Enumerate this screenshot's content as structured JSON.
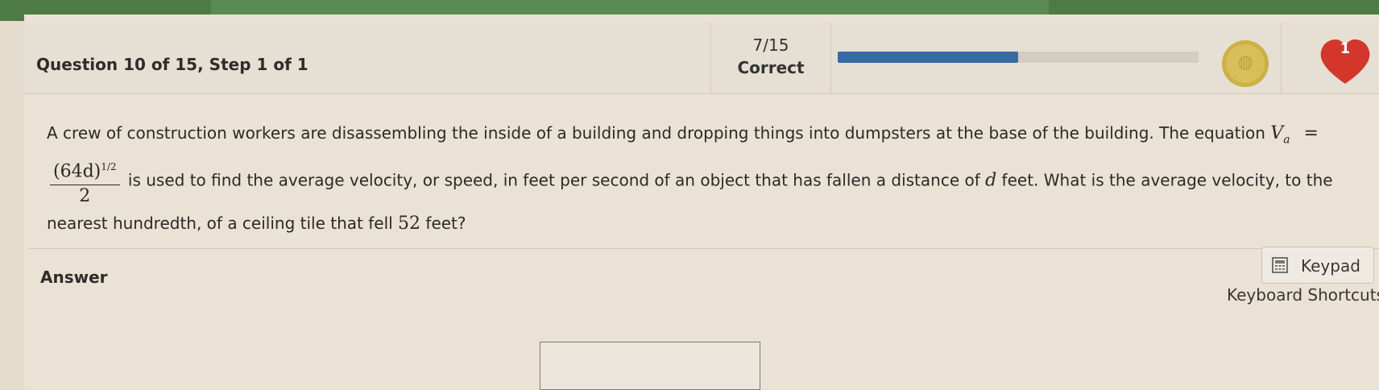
{
  "header": {
    "question_label": "Question 10 of 15, Step 1 of 1",
    "score_fraction": "7/15",
    "score_status": "Correct",
    "progress_fraction": 0.5,
    "hearts_count": "1"
  },
  "question": {
    "text_part1": "A crew of construction workers are disassembling the inside of a building and dropping things into dumpsters at the base of the building. The equation ",
    "eq_lhs_var": "V",
    "eq_lhs_sub": "a",
    "eq_equals": "=",
    "eq_numerator": "(64d)",
    "eq_exponent": "1/2",
    "eq_denominator": "2",
    "text_part2": " is used to find the average velocity, or speed, in feet per second of an object that has fallen a distance of ",
    "var_d": "d",
    "text_part3": " feet. What is the average velocity, to the nearest hundredth, of a ceiling tile that fell ",
    "num_52": "52",
    "text_part4": " feet?"
  },
  "answer": {
    "label": "Answer",
    "keypad_label": "Keypad",
    "shortcuts_label": "Keyboard Shortcuts",
    "input_value": ""
  },
  "colors": {
    "progress_fill": "#3a6aa3",
    "heart": "#d3372c",
    "coin": "#d9bf57",
    "top_bar": "#4d7a45"
  },
  "icons": {
    "coin": "coin-icon",
    "heart": "heart-icon",
    "keypad": "calculator-icon"
  }
}
